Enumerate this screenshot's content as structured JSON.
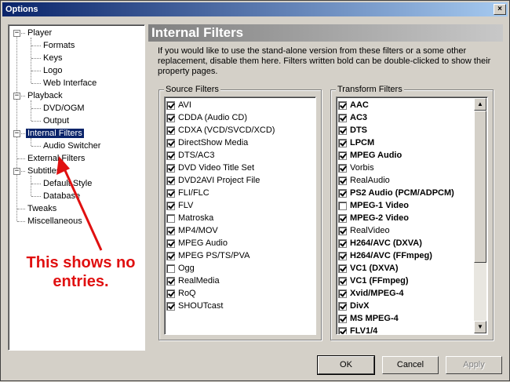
{
  "window": {
    "title": "Options",
    "close_glyph": "×"
  },
  "tree": {
    "items": [
      {
        "label": "Player",
        "level": 0,
        "expander": "−"
      },
      {
        "label": "Formats",
        "level": 1
      },
      {
        "label": "Keys",
        "level": 1
      },
      {
        "label": "Logo",
        "level": 1
      },
      {
        "label": "Web Interface",
        "level": 1
      },
      {
        "label": "Playback",
        "level": 0,
        "expander": "−"
      },
      {
        "label": "DVD/OGM",
        "level": 1
      },
      {
        "label": "Output",
        "level": 1
      },
      {
        "label": "Internal Filters",
        "level": 0,
        "expander": "−",
        "selected": true
      },
      {
        "label": "Audio Switcher",
        "level": 1
      },
      {
        "label": "External Filters",
        "level": 0
      },
      {
        "label": "Subtitles",
        "level": 0,
        "expander": "−"
      },
      {
        "label": "Default Style",
        "level": 1
      },
      {
        "label": "Database",
        "level": 1
      },
      {
        "label": "Tweaks",
        "level": 0
      },
      {
        "label": "Miscellaneous",
        "level": 0
      }
    ]
  },
  "page": {
    "title": "Internal Filters",
    "description": "If you would like to use the stand-alone version from these filters or a some other replacement, disable them here. Filters written bold can be double-clicked to show their property pages."
  },
  "source_filters": {
    "title": "Source Filters",
    "items": [
      {
        "label": "AVI",
        "checked": true,
        "bold": false
      },
      {
        "label": "CDDA (Audio CD)",
        "checked": true,
        "bold": false
      },
      {
        "label": "CDXA (VCD/SVCD/XCD)",
        "checked": true,
        "bold": false
      },
      {
        "label": "DirectShow Media",
        "checked": true,
        "bold": false
      },
      {
        "label": "DTS/AC3",
        "checked": true,
        "bold": false
      },
      {
        "label": "DVD Video Title Set",
        "checked": true,
        "bold": false
      },
      {
        "label": "DVD2AVI Project File",
        "checked": true,
        "bold": false
      },
      {
        "label": "FLI/FLC",
        "checked": true,
        "bold": false
      },
      {
        "label": "FLV",
        "checked": true,
        "bold": false
      },
      {
        "label": "Matroska",
        "checked": false,
        "bold": false
      },
      {
        "label": "MP4/MOV",
        "checked": true,
        "bold": false
      },
      {
        "label": "MPEG Audio",
        "checked": true,
        "bold": false
      },
      {
        "label": "MPEG PS/TS/PVA",
        "checked": true,
        "bold": false
      },
      {
        "label": "Ogg",
        "checked": false,
        "bold": false
      },
      {
        "label": "RealMedia",
        "checked": true,
        "bold": false
      },
      {
        "label": "RoQ",
        "checked": true,
        "bold": false
      },
      {
        "label": "SHOUTcast",
        "checked": true,
        "bold": false
      }
    ]
  },
  "transform_filters": {
    "title": "Transform Filters",
    "items": [
      {
        "label": "AAC",
        "checked": true,
        "bold": true
      },
      {
        "label": "AC3",
        "checked": true,
        "bold": true
      },
      {
        "label": "DTS",
        "checked": true,
        "bold": true
      },
      {
        "label": "LPCM",
        "checked": true,
        "bold": true
      },
      {
        "label": "MPEG Audio",
        "checked": true,
        "bold": true
      },
      {
        "label": "Vorbis",
        "checked": true,
        "bold": false
      },
      {
        "label": "RealAudio",
        "checked": true,
        "bold": false
      },
      {
        "label": "PS2 Audio (PCM/ADPCM)",
        "checked": true,
        "bold": true
      },
      {
        "label": "MPEG-1 Video",
        "checked": false,
        "bold": true
      },
      {
        "label": "MPEG-2 Video",
        "checked": true,
        "bold": true
      },
      {
        "label": "RealVideo",
        "checked": true,
        "bold": false
      },
      {
        "label": "H264/AVC (DXVA)",
        "checked": true,
        "bold": true
      },
      {
        "label": "H264/AVC (FFmpeg)",
        "checked": true,
        "bold": true
      },
      {
        "label": "VC1 (DXVA)",
        "checked": true,
        "bold": true
      },
      {
        "label": "VC1 (FFmpeg)",
        "checked": true,
        "bold": true
      },
      {
        "label": "Xvid/MPEG-4",
        "checked": true,
        "bold": true
      },
      {
        "label": "DivX",
        "checked": true,
        "bold": true
      },
      {
        "label": "MS MPEG-4",
        "checked": true,
        "bold": true
      },
      {
        "label": "FLV1/4",
        "checked": true,
        "bold": true
      }
    ]
  },
  "buttons": {
    "ok": "OK",
    "cancel": "Cancel",
    "apply": "Apply"
  },
  "annotation": {
    "text": "This shows no entries.",
    "color": "#e01010"
  },
  "icons": {
    "scroll_up": "▲",
    "scroll_down": "▼"
  }
}
